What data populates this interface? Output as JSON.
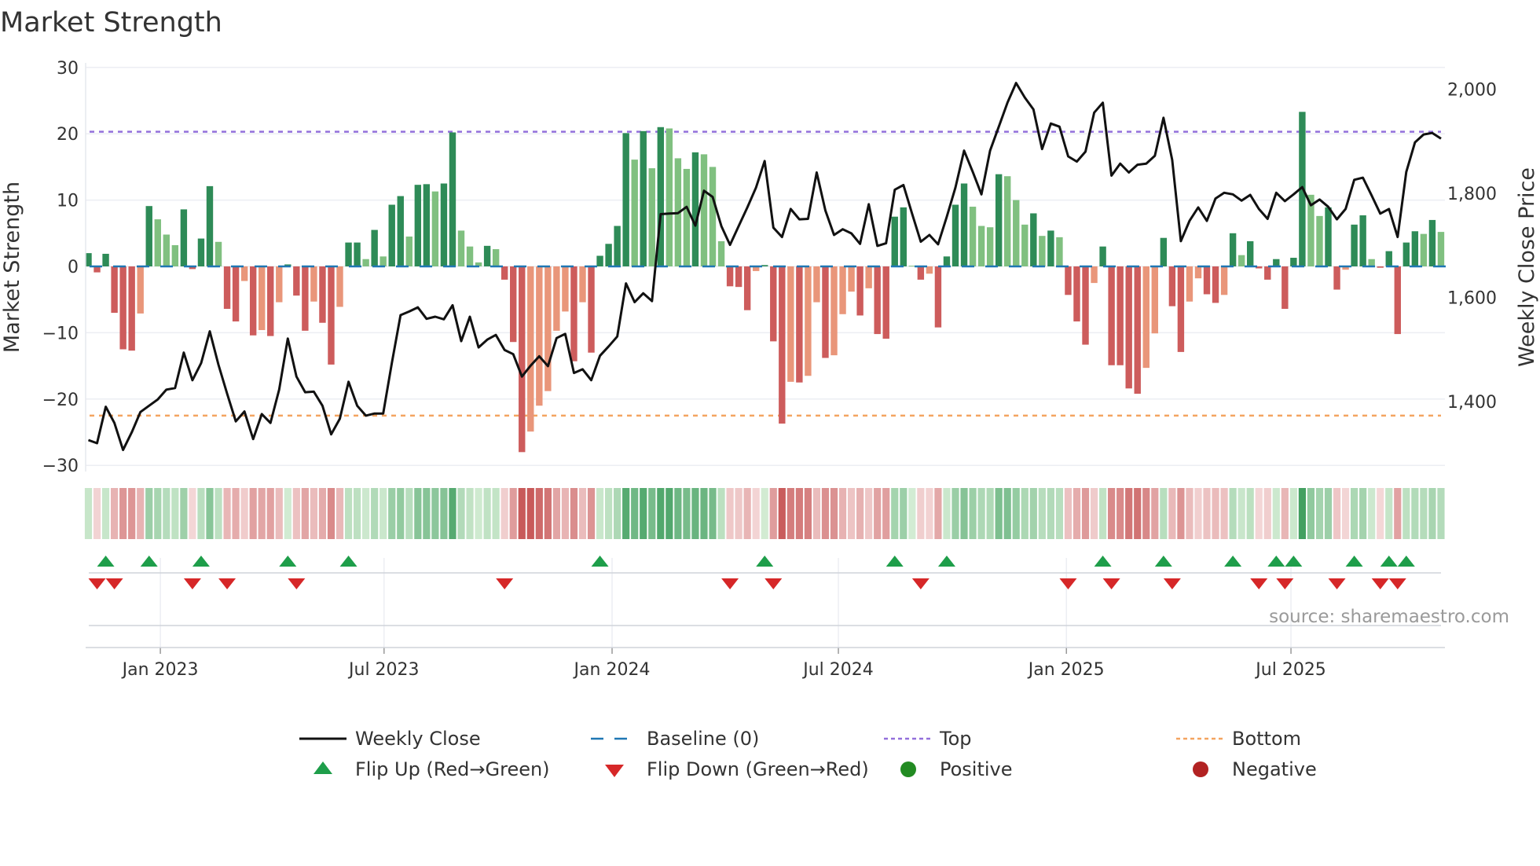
{
  "chart_data": {
    "type": "bar",
    "title": "Market Strength",
    "ylabel": "Market Strength",
    "y2label": "Weekly Close Price",
    "ylim": [
      -30,
      30
    ],
    "yticks": [
      "30",
      "20",
      "10",
      "0",
      "−10",
      "−20",
      "−30"
    ],
    "ytick_values": [
      30,
      20,
      10,
      0,
      -10,
      -20,
      -30
    ],
    "y2ticks": [
      "2,000",
      "1,800",
      "1,600",
      "1,400"
    ],
    "y2tick_values": [
      2000,
      1800,
      1600,
      1400
    ],
    "xticks": [
      {
        "label": "Jan 2023",
        "week": 8.3
      },
      {
        "label": "Jul 2023",
        "week": 34.1
      },
      {
        "label": "Jan 2024",
        "week": 60.4
      },
      {
        "label": "Jul 2024",
        "week": 86.5
      },
      {
        "label": "Jan 2025",
        "week": 112.8
      },
      {
        "label": "Jul 2025",
        "week": 138.7
      }
    ],
    "top_level": 20.3,
    "bottom_level": -22.5,
    "grid": true,
    "legend_position": "bottom",
    "strength": [
      2.0,
      -0.9,
      1.9,
      -7.0,
      -12.5,
      -12.7,
      -7.1,
      9.1,
      7.1,
      4.8,
      3.2,
      8.6,
      -0.4,
      4.2,
      12.1,
      3.7,
      -6.4,
      -8.3,
      -2.2,
      -10.4,
      -9.6,
      -10.5,
      -5.4,
      0.3,
      -4.4,
      -9.7,
      -5.3,
      -8.5,
      -14.8,
      -6.1,
      3.6,
      3.6,
      1.1,
      5.5,
      1.5,
      9.3,
      10.6,
      4.5,
      12.3,
      12.4,
      11.3,
      12.5,
      20.2,
      5.4,
      3.0,
      0.6,
      3.1,
      2.6,
      -2.0,
      -11.4,
      -28.0,
      -24.9,
      -21.0,
      -18.8,
      -9.7,
      -6.8,
      -14.3,
      -5.4,
      -13.0,
      1.6,
      3.4,
      6.1,
      20.1,
      16.1,
      20.4,
      14.8,
      21.0,
      20.8,
      16.3,
      14.7,
      17.2,
      16.9,
      15.0,
      3.8,
      -3.0,
      -3.1,
      -6.6,
      -0.7,
      0.2,
      -11.3,
      -23.7,
      -17.4,
      -17.5,
      -16.5,
      -5.4,
      -13.8,
      -13.4,
      -7.2,
      -3.8,
      -7.4,
      -3.3,
      -10.2,
      -10.9,
      7.5,
      8.9,
      0.1,
      -2.0,
      -1.1,
      -9.2,
      1.5,
      9.3,
      12.5,
      9.0,
      6.1,
      5.9,
      13.9,
      13.6,
      10.0,
      6.3,
      8.0,
      4.6,
      5.4,
      4.4,
      -4.3,
      -8.3,
      -11.8,
      -2.5,
      3.0,
      -14.9,
      -14.9,
      -18.4,
      -19.2,
      -15.3,
      -10.1,
      4.3,
      -6.0,
      -12.9,
      -5.3,
      -1.8,
      -4.2,
      -5.5,
      -4.3,
      5.0,
      1.7,
      3.8,
      -0.3,
      -2.0,
      1.1,
      -6.4,
      1.3,
      23.3,
      10.8,
      7.6,
      8.9,
      -3.5,
      -0.5,
      6.3,
      7.7,
      1.1,
      -0.2,
      2.3,
      -10.2,
      3.6,
      5.3,
      4.9,
      7.0,
      5.2
    ],
    "weekly_close": [
      1326,
      1320,
      1390,
      1359,
      1307,
      1341,
      1380,
      1392,
      1404,
      1423,
      1426,
      1494,
      1441,
      1474,
      1535,
      1471,
      1415,
      1362,
      1381,
      1328,
      1376,
      1359,
      1423,
      1521,
      1448,
      1418,
      1419,
      1392,
      1337,
      1367,
      1438,
      1392,
      1373,
      1377,
      1377,
      1474,
      1566,
      1573,
      1581,
      1559,
      1563,
      1558,
      1585,
      1516,
      1563,
      1504,
      1519,
      1528,
      1499,
      1491,
      1448,
      1469,
      1487,
      1468,
      1522,
      1530,
      1455,
      1462,
      1441,
      1488,
      1506,
      1525,
      1627,
      1591,
      1608,
      1593,
      1760,
      1761,
      1762,
      1774,
      1738,
      1805,
      1793,
      1737,
      1701,
      1737,
      1773,
      1811,
      1862,
      1734,
      1716,
      1770,
      1750,
      1751,
      1840,
      1767,
      1720,
      1731,
      1723,
      1703,
      1779,
      1699,
      1704,
      1807,
      1816,
      1761,
      1707,
      1720,
      1702,
      1755,
      1811,
      1882,
      1841,
      1798,
      1882,
      1928,
      1974,
      2012,
      1984,
      1961,
      1885,
      1934,
      1928,
      1871,
      1861,
      1880,
      1955,
      1974,
      1834,
      1857,
      1840,
      1855,
      1857,
      1872,
      1945,
      1864,
      1708,
      1747,
      1773,
      1747,
      1790,
      1801,
      1798,
      1786,
      1797,
      1770,
      1751,
      1801,
      1785,
      1798,
      1812,
      1777,
      1788,
      1774,
      1750,
      1770,
      1826,
      1830,
      1796,
      1761,
      1770,
      1716,
      1841,
      1898,
      1913,
      1916,
      1905
    ],
    "y2lim": [
      1270,
      2080
    ],
    "legend": [
      {
        "label": "Weekly Close",
        "kind": "line"
      },
      {
        "label": "Baseline (0)",
        "kind": "dash"
      },
      {
        "label": "Top",
        "kind": "dot-top"
      },
      {
        "label": "Bottom",
        "kind": "dot-bottom"
      },
      {
        "label": "Flip Up (Red→Green)",
        "kind": "tri-up"
      },
      {
        "label": "Flip Down (Green→Red)",
        "kind": "tri-down"
      },
      {
        "label": "Positive",
        "kind": "dot-pos"
      },
      {
        "label": "Negative",
        "kind": "dot-neg"
      }
    ],
    "colors": {
      "pos_strong": "#2e8b57",
      "pos_weak": "#80c080",
      "neg_strong": "#cd5c5c",
      "neg_weak": "#e9967a",
      "baseline": "#1f77b4",
      "top": "#9370db",
      "bottom": "#f4a460",
      "close": "#111111",
      "flip_up": "#1e9e4a",
      "flip_down": "#d62728",
      "positive": "#228b22",
      "negative": "#b22222"
    }
  },
  "source": "source: sharemaestro.com"
}
